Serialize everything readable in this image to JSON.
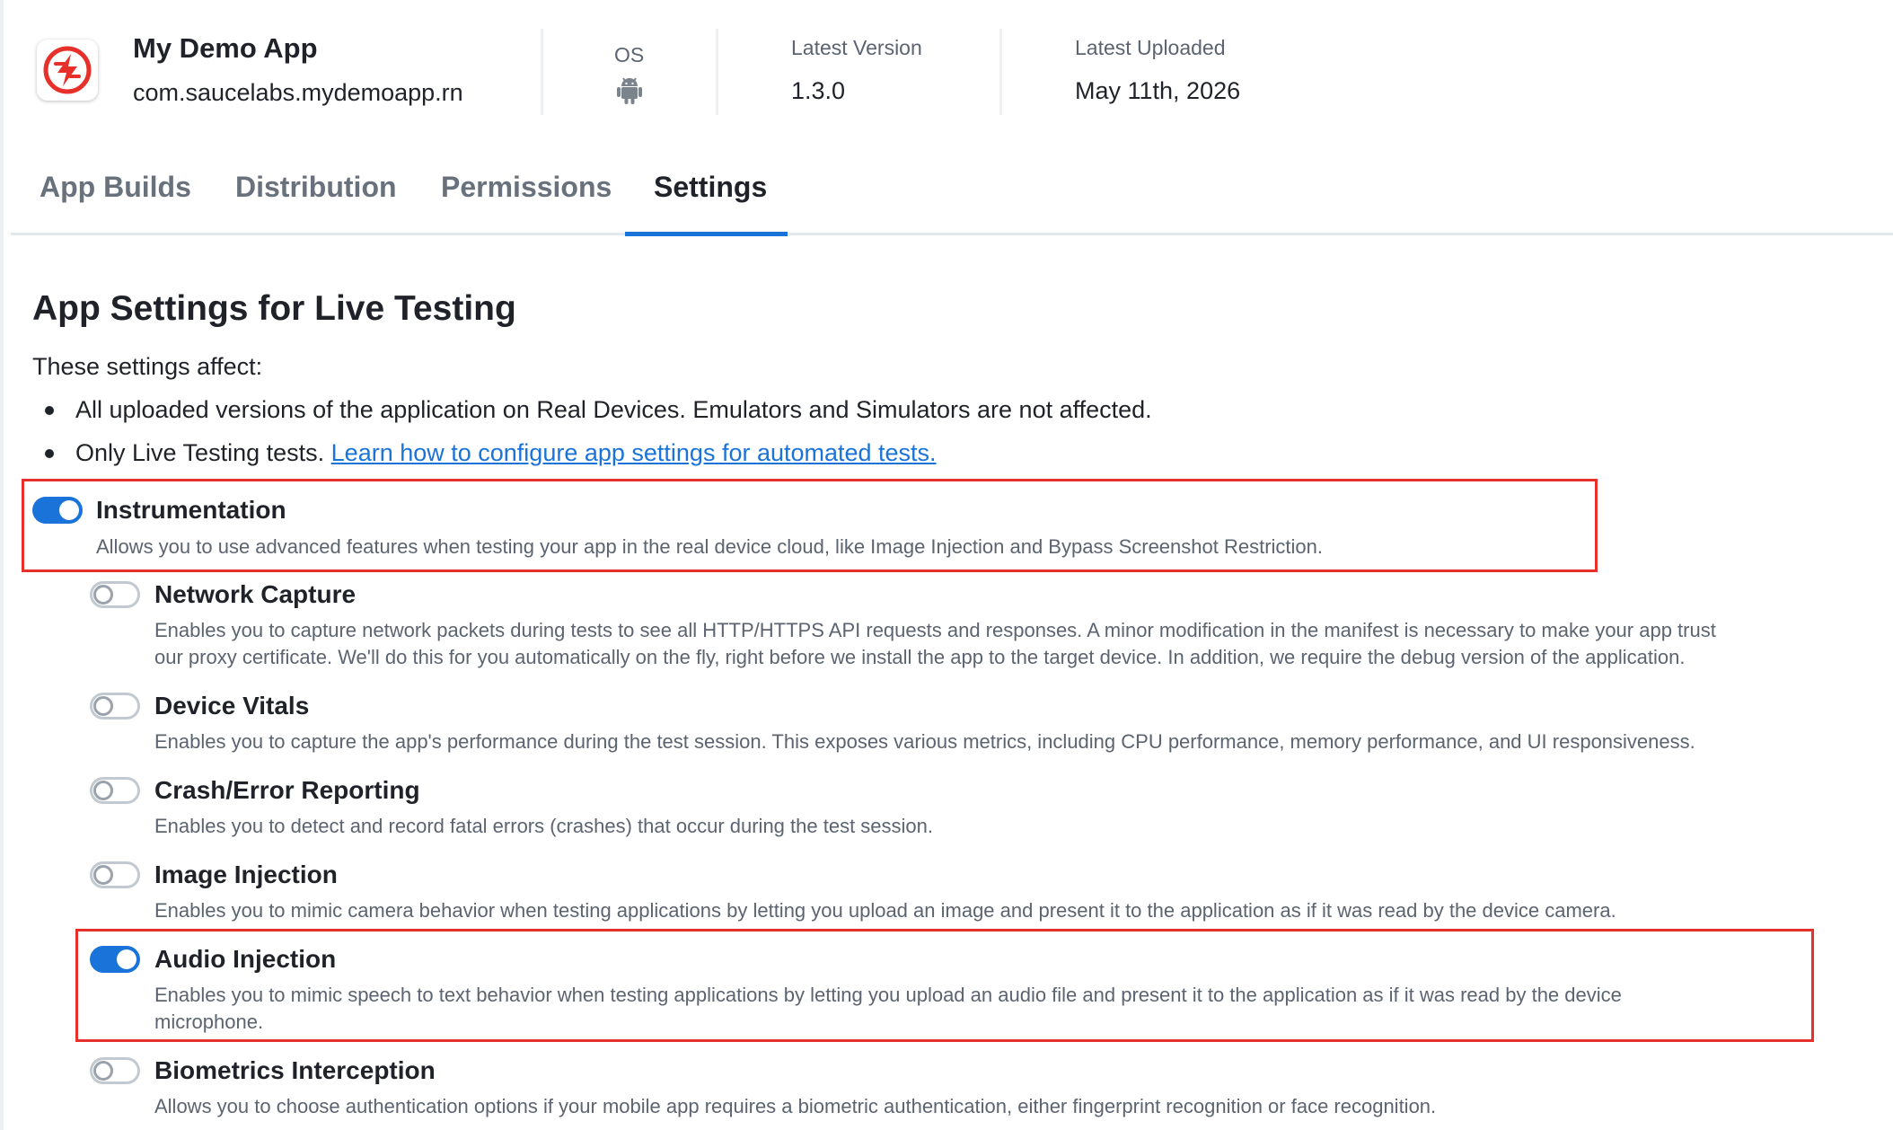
{
  "app": {
    "name": "My Demo App",
    "package": "com.saucelabs.mydemoapp.rn",
    "logo_icon": "saucelabs-bolt-icon"
  },
  "meta": {
    "os_label": "OS",
    "os_icon": "android-icon",
    "latest_version_label": "Latest Version",
    "latest_version_value": "1.3.0",
    "latest_uploaded_label": "Latest Uploaded",
    "latest_uploaded_value": "May 11th, 2026"
  },
  "tabs": [
    {
      "label": "App Builds",
      "active": false
    },
    {
      "label": "Distribution",
      "active": false
    },
    {
      "label": "Permissions",
      "active": false
    },
    {
      "label": "Settings",
      "active": true
    }
  ],
  "content": {
    "title": "App Settings for Live Testing",
    "intro": "These settings affect:",
    "bullet_1": "All uploaded versions of the application on Real Devices. Emulators and Simulators are not affected.",
    "bullet_2_text": "Only Live Testing tests.",
    "bullet_2_link": "Learn how to configure app settings for automated tests."
  },
  "settings": [
    {
      "title": "Instrumentation",
      "enabled": true,
      "desc": "Allows you to use advanced features when testing your app in the real device cloud, like Image Injection and Bypass Screenshot Restriction."
    },
    {
      "title": "Network Capture",
      "enabled": false,
      "desc_1": "Enables you to capture network packets during tests to see all HTTP/HTTPS API requests and responses. A minor modification in the manifest is necessary to make your app trust",
      "desc_2": "our proxy certificate. We'll do this for you automatically on the fly, right before we install the app to the target device. In addition, we require the debug version of the application."
    },
    {
      "title": "Device Vitals",
      "enabled": false,
      "desc": "Enables you to capture the app's performance during the test session. This exposes various metrics, including CPU performance, memory performance, and UI responsiveness."
    },
    {
      "title": "Crash/Error Reporting",
      "enabled": false,
      "desc": "Enables you to detect and record fatal errors (crashes) that occur during the test session."
    },
    {
      "title": "Image Injection",
      "enabled": false,
      "desc": "Enables you to mimic camera behavior when testing applications by letting you upload an image and present it to the application as if it was read by the device camera."
    },
    {
      "title": "Audio Injection",
      "enabled": true,
      "desc_1": "Enables you to mimic speech to text behavior when testing applications by letting you upload an audio file and present it to the application as if it was read by the device",
      "desc_2": "microphone."
    },
    {
      "title": "Biometrics Interception",
      "enabled": false,
      "desc": "Allows you to choose authentication options if your mobile app requires a biometric authentication, either fingerprint recognition or face recognition."
    }
  ],
  "colors": {
    "accent": "#1a73d9",
    "highlight": "#e8302a",
    "brand_red": "#e8302a"
  }
}
